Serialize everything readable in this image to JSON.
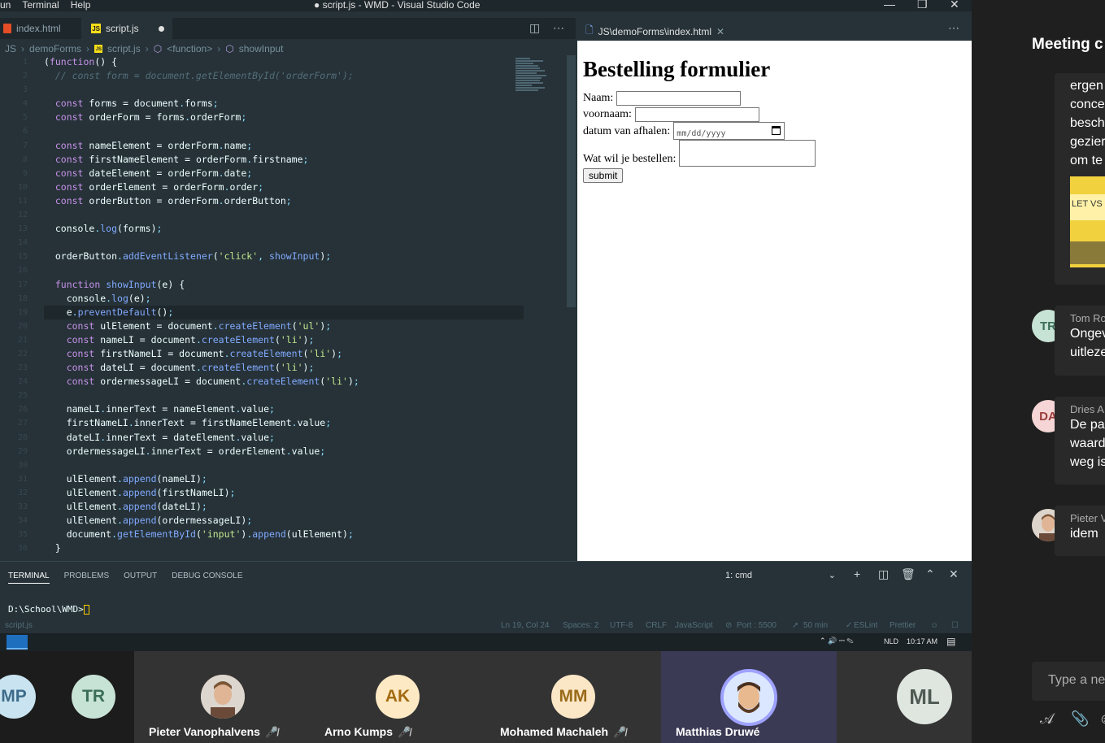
{
  "titlebar": {
    "menu": [
      "un",
      "Terminal",
      "Help"
    ],
    "title": "● script.js - WMD - Visual Studio Code"
  },
  "tabs": [
    {
      "label": "index.html",
      "icon": "html5-icon"
    },
    {
      "label": "script.js",
      "icon": "js-icon",
      "dirty": true
    }
  ],
  "preview_tab": {
    "label": "JS\\demoForms\\index.html"
  },
  "breadcrumb": [
    "JS",
    "demoForms",
    "script.js",
    "<function>",
    "showInput"
  ],
  "editor": {
    "line_numbers": [
      "1",
      "2",
      "3",
      "4",
      "5",
      "6",
      "7",
      "8",
      "9",
      "10",
      "11",
      "12",
      "13",
      "14",
      "15",
      "16",
      "17",
      "18",
      "19",
      "20",
      "21",
      "22",
      "23",
      "24",
      "25",
      "26",
      "27",
      "28",
      "29",
      "30",
      "31",
      "32",
      "33",
      "34",
      "35",
      "36"
    ],
    "lines": [
      "(function() {",
      "  // const form = document.getElementById('orderForm');",
      "",
      "  const forms = document.forms;",
      "  const orderForm = forms.orderForm;",
      "",
      "  const nameElement = orderForm.name;",
      "  const firstNameElement = orderForm.firstname;",
      "  const dateElement = orderForm.date;",
      "  const orderElement = orderForm.order;",
      "  const orderButton = orderForm.orderButton;",
      "",
      "  console.log(forms);",
      "",
      "  orderButton.addEventListener('click', showInput);",
      "",
      "  function showInput(e) {",
      "    console.log(e);",
      "    e.preventDefault();",
      "    const ulElement = document.createElement('ul');",
      "    const nameLI = document.createElement('li');",
      "    const firstNameLI = document.createElement('li');",
      "    const dateLI = document.createElement('li');",
      "    const ordermessageLI = document.createElement('li');",
      "",
      "    nameLI.innerText = nameElement.value;",
      "    firstNameLI.innerText = firstNameElement.value;",
      "    dateLI.innerText = dateElement.value;",
      "    ordermessageLI.innerText = orderElement.value;",
      "",
      "    ulElement.append(nameLI);",
      "    ulElement.append(firstNameLI);",
      "    ulElement.append(dateLI);",
      "    ulElement.append(ordermessageLI);",
      "    document.getElementById('input').append(ulElement);",
      "  }"
    ],
    "current_line": 19
  },
  "preview": {
    "heading": "Bestelling formulier",
    "name_label": "Naam:",
    "firstname_label": "voornaam:",
    "date_label": "datum van afhalen:",
    "date_placeholder": "mm/dd/yyyy",
    "order_label": "Wat wil je bestellen:",
    "submit_label": "submit"
  },
  "panel": {
    "tabs": [
      "TERMINAL",
      "PROBLEMS",
      "OUTPUT",
      "DEBUG CONSOLE"
    ],
    "terminal_select": "1: cmd",
    "prompt": "D:\\School\\WMD>"
  },
  "statusbar": {
    "file": "script.js",
    "position": "Ln 19, Col 24",
    "spaces": "Spaces: 2",
    "encoding": "UTF-8",
    "eol": "CRLF",
    "language": "JavaScript",
    "port": "Port : 5500",
    "time": "50 min",
    "eslint": "ESLint",
    "prettier": "Prettier"
  },
  "taskbar": {
    "lang": "NLD",
    "clock": "10:17 AM"
  },
  "participants": [
    {
      "initials": "MP",
      "name": "",
      "bg": "#c9e4f0",
      "fg": "#3e6b8a"
    },
    {
      "initials": "TR",
      "name": "",
      "bg": "#c7e3d5",
      "fg": "#3b6e57"
    },
    {
      "initials": "",
      "name": "Pieter Vanophalvens",
      "photo": true,
      "muted": true
    },
    {
      "initials": "AK",
      "name": "Arno Kumps",
      "bg": "#fde9c4",
      "fg": "#a36b12",
      "muted": true
    },
    {
      "initials": "MM",
      "name": "Mohamed Machaleh",
      "bg": "#fbe7c6",
      "fg": "#9a6a18",
      "muted": true
    },
    {
      "initials": "",
      "name": "Matthias Druwé",
      "photo": true,
      "speaking": true
    },
    {
      "initials": "ML",
      "name": "",
      "bg": "#dfe6e0",
      "fg": "#505a54"
    }
  ],
  "chat": {
    "title": "Meeting c",
    "first_message": [
      "ergen",
      "conce",
      "besch",
      "gezier",
      "om te"
    ],
    "messages": [
      {
        "initials": "TR",
        "sender": "Tom Ro",
        "text": [
          "Ongev",
          "uitleze"
        ],
        "bg": "#c7e3d5",
        "fg": "#3b6e57"
      },
      {
        "initials": "DA",
        "sender": "Dries A",
        "text": [
          "De pa",
          "waard",
          "weg is"
        ],
        "bg": "#f5d5d5",
        "fg": "#9a3b3b"
      },
      {
        "initials": "",
        "sender": "Pieter V",
        "text": [
          "idem"
        ],
        "photo": true
      }
    ],
    "compose_placeholder": "Type a ne"
  }
}
